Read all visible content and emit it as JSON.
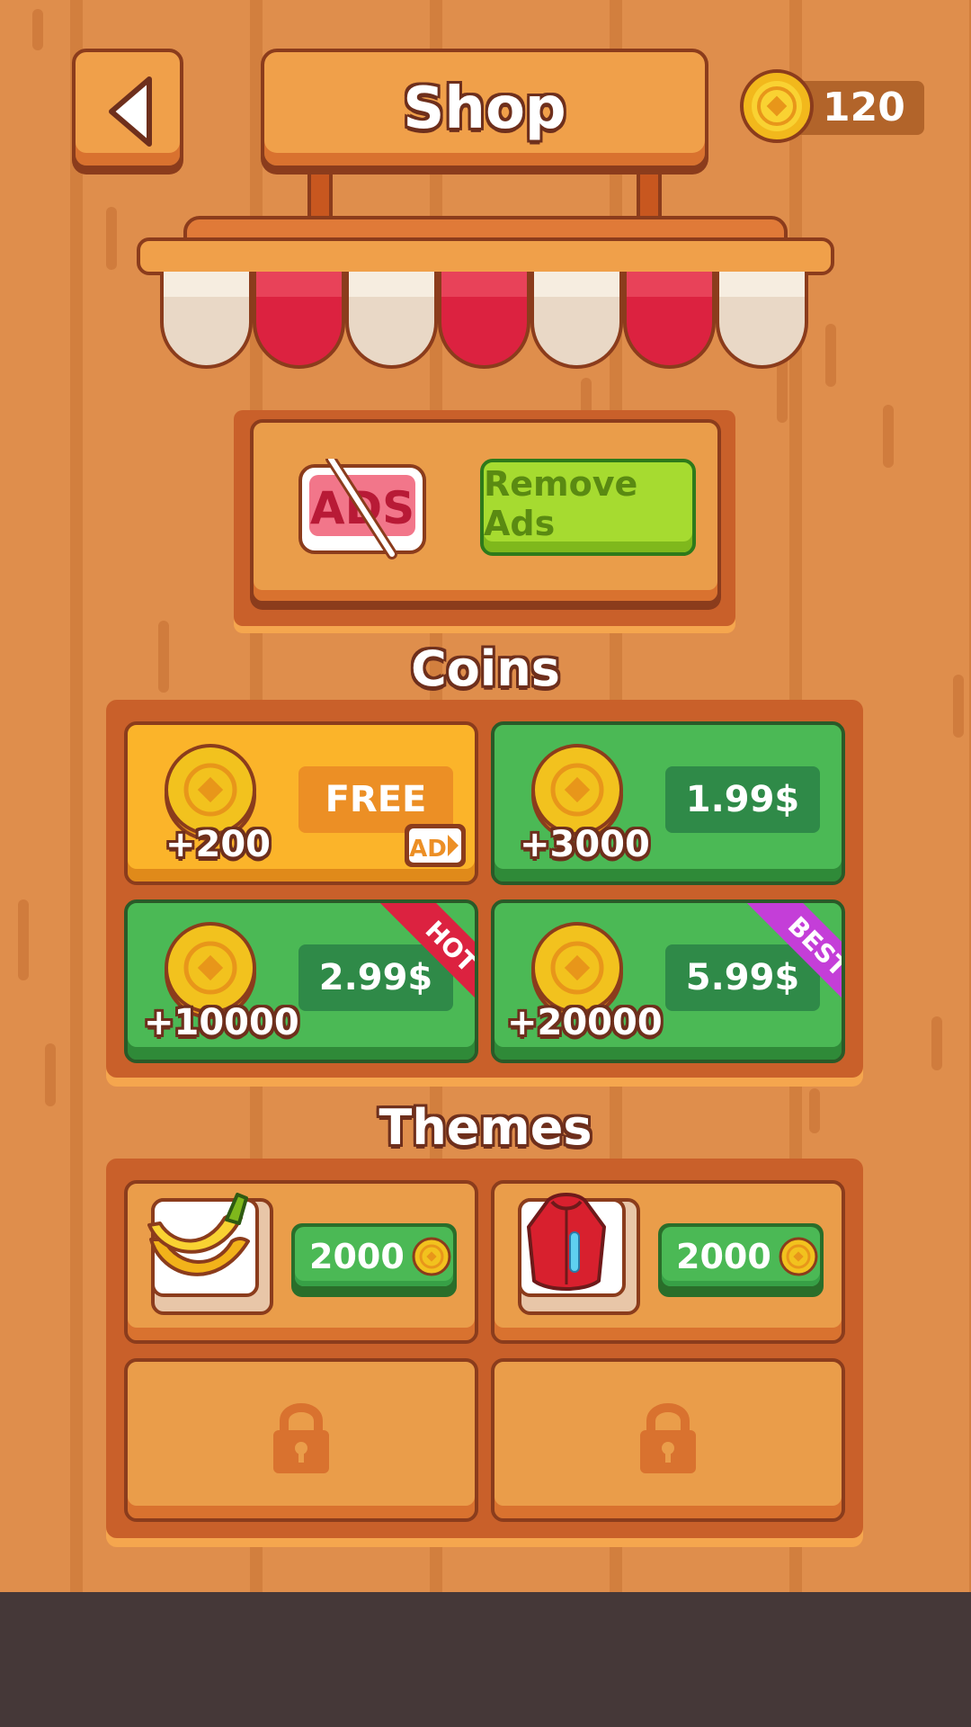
{
  "header": {
    "title": "Shop",
    "coin_balance": "120"
  },
  "remove_ads": {
    "icon_text": "ADS",
    "button_label": "Remove Ads"
  },
  "coins": {
    "title": "Coins",
    "packs": [
      {
        "amount": "+200",
        "price": "FREE",
        "ad_badge": "AD",
        "ribbon": ""
      },
      {
        "amount": "+3000",
        "price": "1.99$",
        "ribbon": ""
      },
      {
        "amount": "+10000",
        "price": "2.99$",
        "ribbon": "HOT"
      },
      {
        "amount": "+20000",
        "price": "5.99$",
        "ribbon": "BEST"
      }
    ]
  },
  "themes": {
    "title": "Themes",
    "items": [
      {
        "icon": "banana-icon",
        "price": "2000",
        "locked": false
      },
      {
        "icon": "jacket-icon",
        "price": "2000",
        "locked": false
      },
      {
        "icon": "lock-icon",
        "locked": true
      },
      {
        "icon": "lock-icon",
        "locked": true
      }
    ]
  },
  "colors": {
    "wood": "#df8e4c",
    "green_card": "#4bb955",
    "yellow_card": "#fbb42a",
    "hot_ribbon": "#dc2240",
    "best_ribbon": "#c43ed8",
    "bottom_bar": "#453838"
  }
}
